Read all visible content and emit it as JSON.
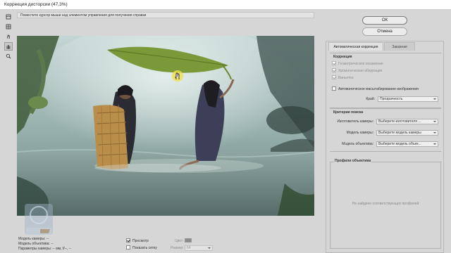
{
  "window": {
    "title": "Коррекция дисторсии (47,3%)"
  },
  "hint": {
    "text": "Поместите курсор мыши над элементом управления для получения справки"
  },
  "tools": [
    {
      "name": "remove-distortion-tool",
      "icon": "distortion-icon"
    },
    {
      "name": "straighten-tool",
      "icon": "grid-icon"
    },
    {
      "name": "move-grid-tool",
      "icon": "hand-pointer-icon"
    },
    {
      "name": "hand-tool",
      "icon": "hand-icon"
    },
    {
      "name": "zoom-tool",
      "icon": "zoom-icon"
    }
  ],
  "buttons": {
    "ok": "ОК",
    "cancel": "Отмена"
  },
  "tabs": {
    "auto": "Автоматическая коррекция",
    "custom": "Заказная"
  },
  "correction": {
    "heading": "Коррекция",
    "geometric": "Геометрическое искажение",
    "chromatic": "Хроматическая аберрация",
    "vignette": "Виньетка",
    "auto_scale": "Автоматическое масштабирование изображения",
    "edge_label": "Край:",
    "edge_value": "Прозрачность"
  },
  "search": {
    "heading": "Критерии поиска",
    "camera_make_label": "Изготовитель камеры:",
    "camera_make_value": "Выберите изготовителя ...",
    "camera_model_label": "Модель камеры:",
    "camera_model_value": "Выберите модель камеры",
    "lens_model_label": "Модель объектива:",
    "lens_model_value": "Выберите модель объек..."
  },
  "profiles": {
    "heading": "Профили объектива",
    "empty": "Не найдено соответствующих профилей"
  },
  "bottom": {
    "camera_model": "Модель камеры: --",
    "lens_model": "Модель объектива: --",
    "camera_params": "Параметры камеры: -- мм, f/--, --",
    "preview": "Просмотр",
    "show_grid": "Показать сетку",
    "color_label": "Цвет:",
    "size_label": "Размер:",
    "size_value": "64"
  },
  "colors": {
    "canvas_bg": "#7f9693",
    "swatch": "#8c8c8c"
  }
}
